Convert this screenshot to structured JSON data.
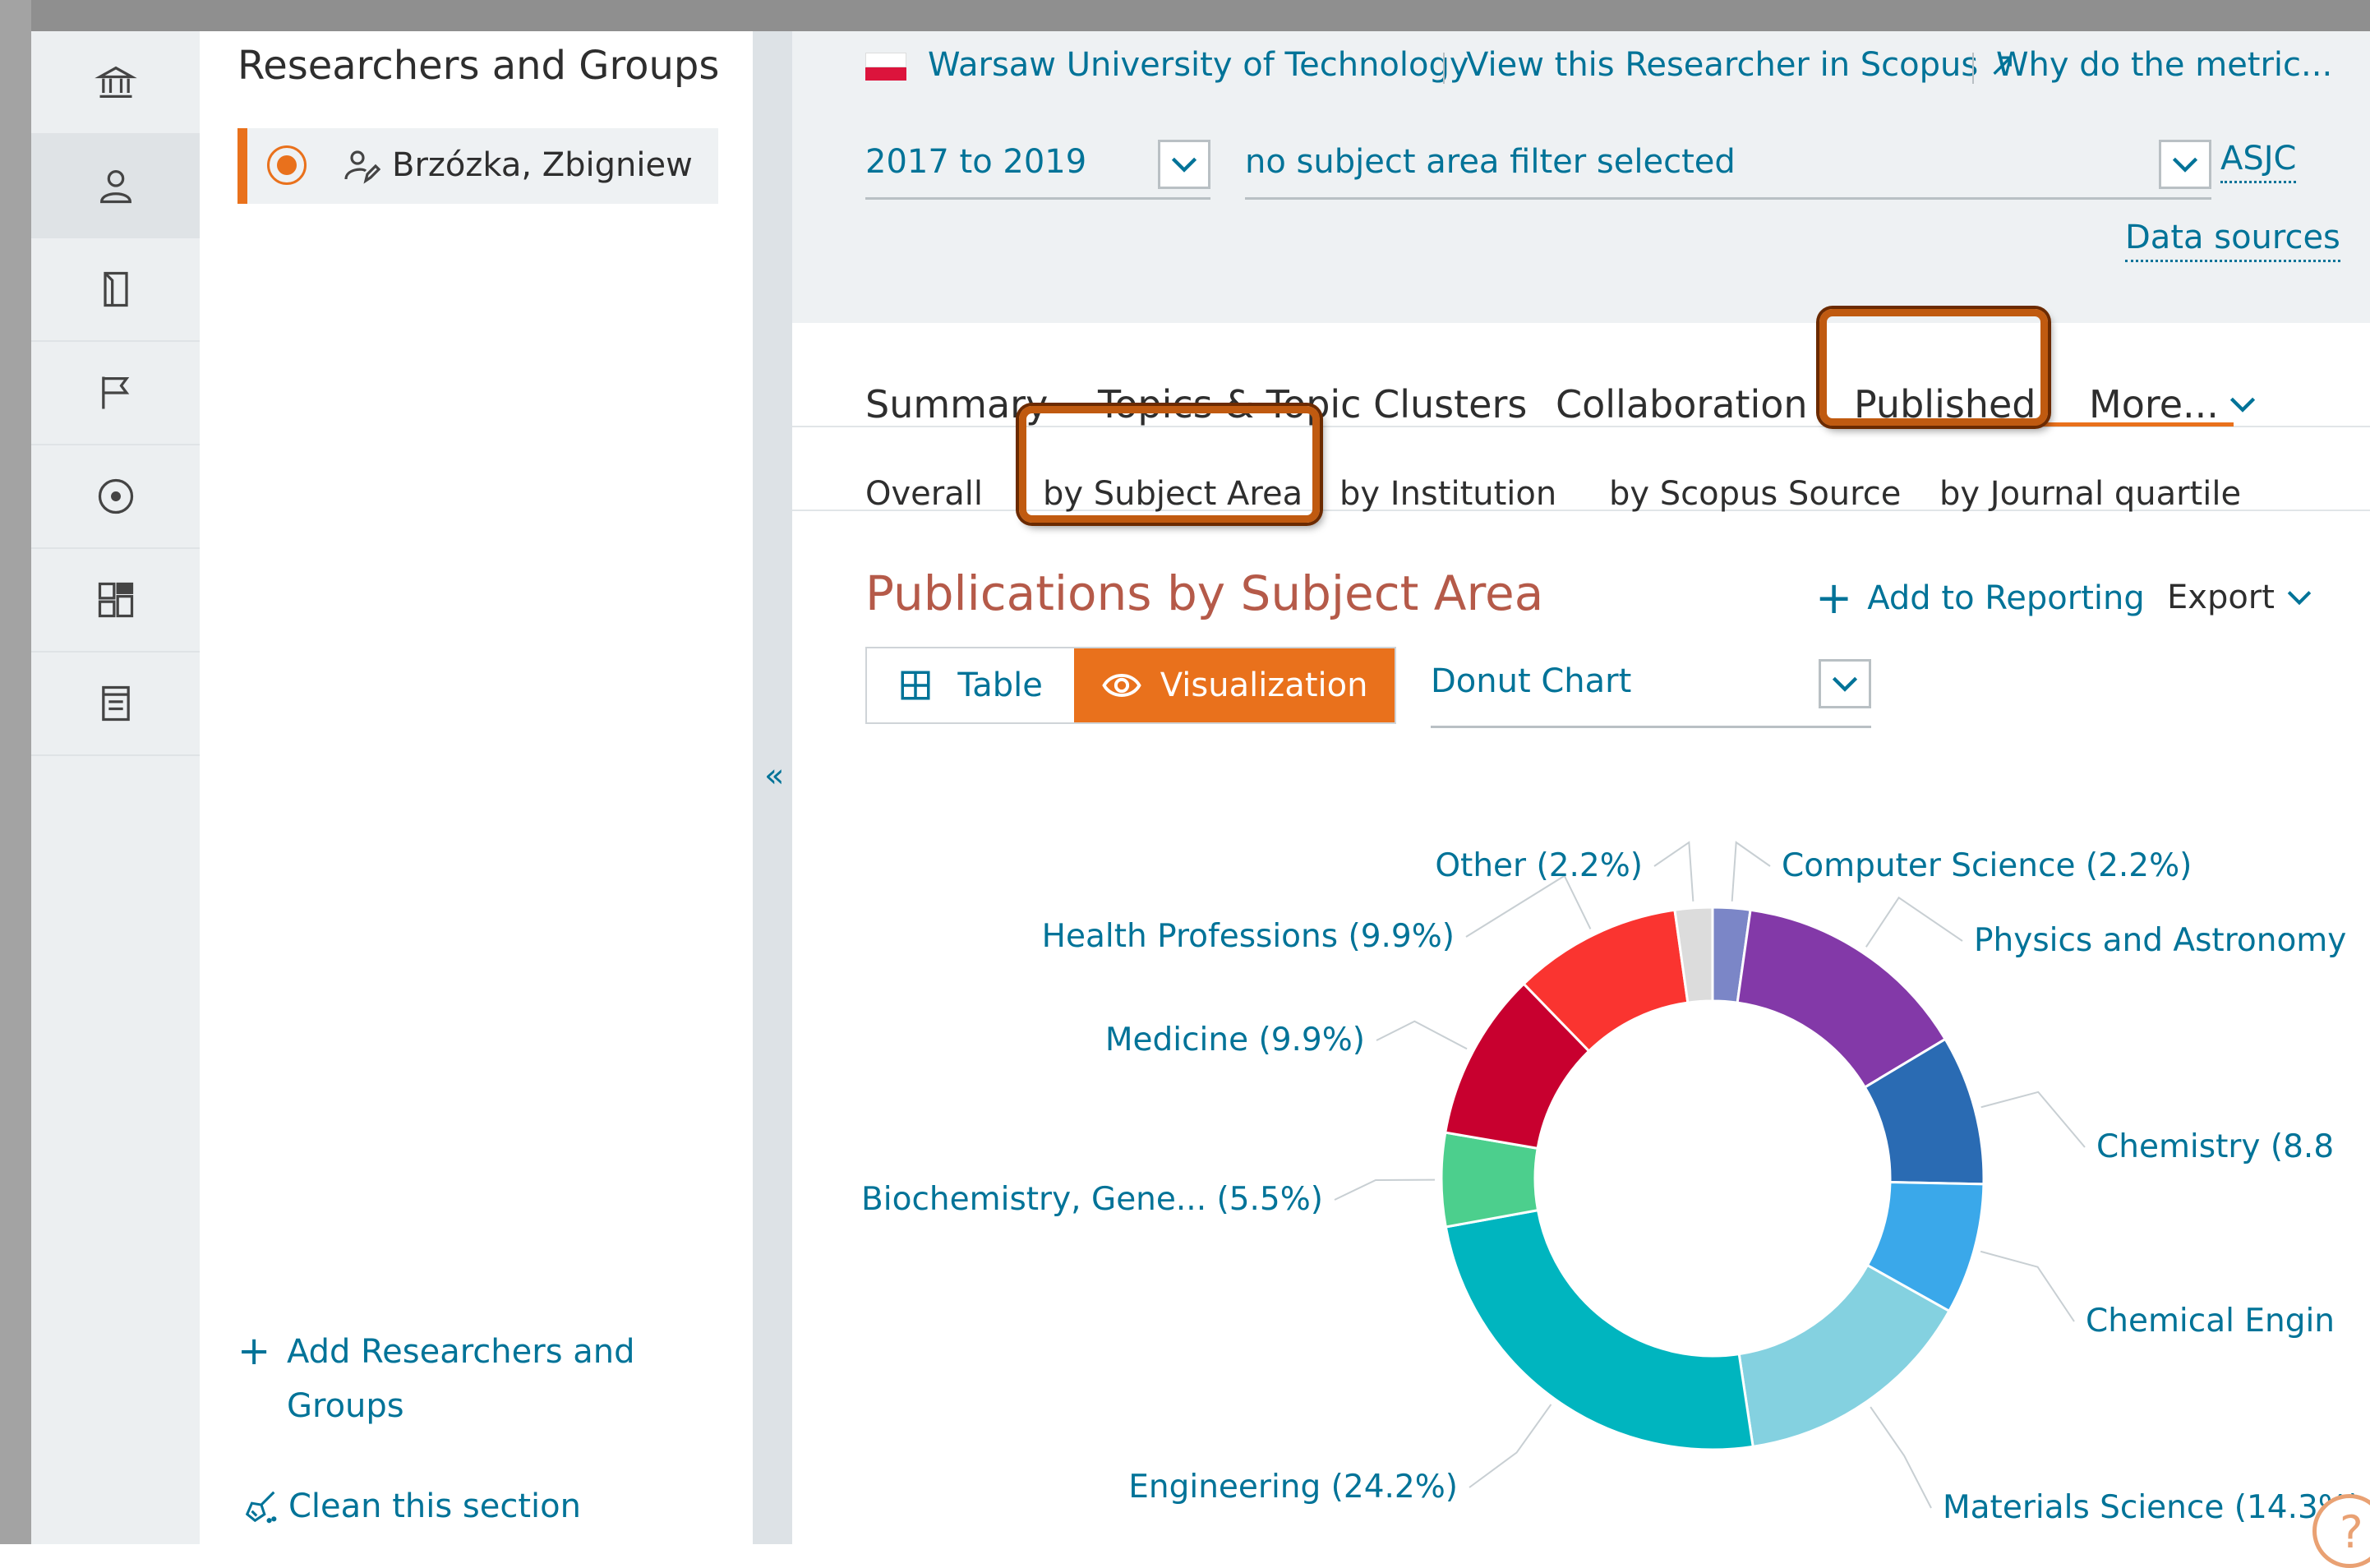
{
  "rail": {
    "items": [
      {
        "icon": "institution-icon"
      },
      {
        "icon": "person-icon",
        "active": true
      },
      {
        "icon": "book-icon"
      },
      {
        "icon": "flag-icon"
      },
      {
        "icon": "target-icon"
      },
      {
        "icon": "dashboard-icon"
      },
      {
        "icon": "report-icon"
      }
    ]
  },
  "panel": {
    "title": "Researchers and Groups",
    "researcher_name": "Brzózka, Zbigniew",
    "add_label_line1": "Add Researchers and",
    "add_label_line2": "Groups",
    "clean_label": "Clean this section"
  },
  "header": {
    "institution": "Warsaw University of Technology",
    "view_scopus": "View this Researcher in Scopus ↗",
    "why_metrics": "Why do the metric...",
    "date_range": "2017 to 2019",
    "subject_filter": "no subject area filter selected",
    "asjc": "ASJC",
    "data_sources": "Data sources"
  },
  "tabs": [
    "Summary",
    "Topics & Topic Clusters",
    "Collaboration",
    "Published",
    "More..."
  ],
  "active_tab": "Published",
  "subtabs": [
    "Overall",
    "by Subject Area",
    "by Institution",
    "by Scopus Source",
    "by Journal quartile"
  ],
  "active_subtab": "by Subject Area",
  "section": {
    "title": "Publications by Subject Area",
    "add_reporting": "Add to Reporting",
    "export": "Export",
    "table_label": "Table",
    "visualization_label": "Visualization",
    "chart_type": "Donut Chart"
  },
  "colors": {
    "accent": "#e9711c",
    "link": "#007398",
    "title": "#b55a49"
  },
  "chart_data": {
    "type": "pie",
    "variant": "donut",
    "series": [
      {
        "label": "Computer Science (2.2%)",
        "value": 2.2,
        "color": "#7b86c7"
      },
      {
        "label": "Physics and Astronomy",
        "value": 14.0,
        "color": "#8339a8"
      },
      {
        "label": "Chemistry (8.8",
        "value": 8.8,
        "color": "#2a6bb3"
      },
      {
        "label": "Chemical Engin",
        "value": 7.7,
        "color": "#3aa8ea"
      },
      {
        "label": "Materials Science (14.3%)",
        "value": 14.3,
        "color": "#84d1e0"
      },
      {
        "label": "Engineering (24.2%)",
        "value": 24.2,
        "color": "#00b5bf"
      },
      {
        "label": "Biochemistry, Gene... (5.5%)",
        "value": 5.5,
        "color": "#4ccf8d"
      },
      {
        "label": "Medicine (9.9%)",
        "value": 9.9,
        "color": "#c8002f"
      },
      {
        "label": "Health Professions (9.9%)",
        "value": 9.9,
        "color": "#fa3430"
      },
      {
        "label": "Other (2.2%)",
        "value": 2.2,
        "color": "#dcdcdc"
      }
    ]
  }
}
